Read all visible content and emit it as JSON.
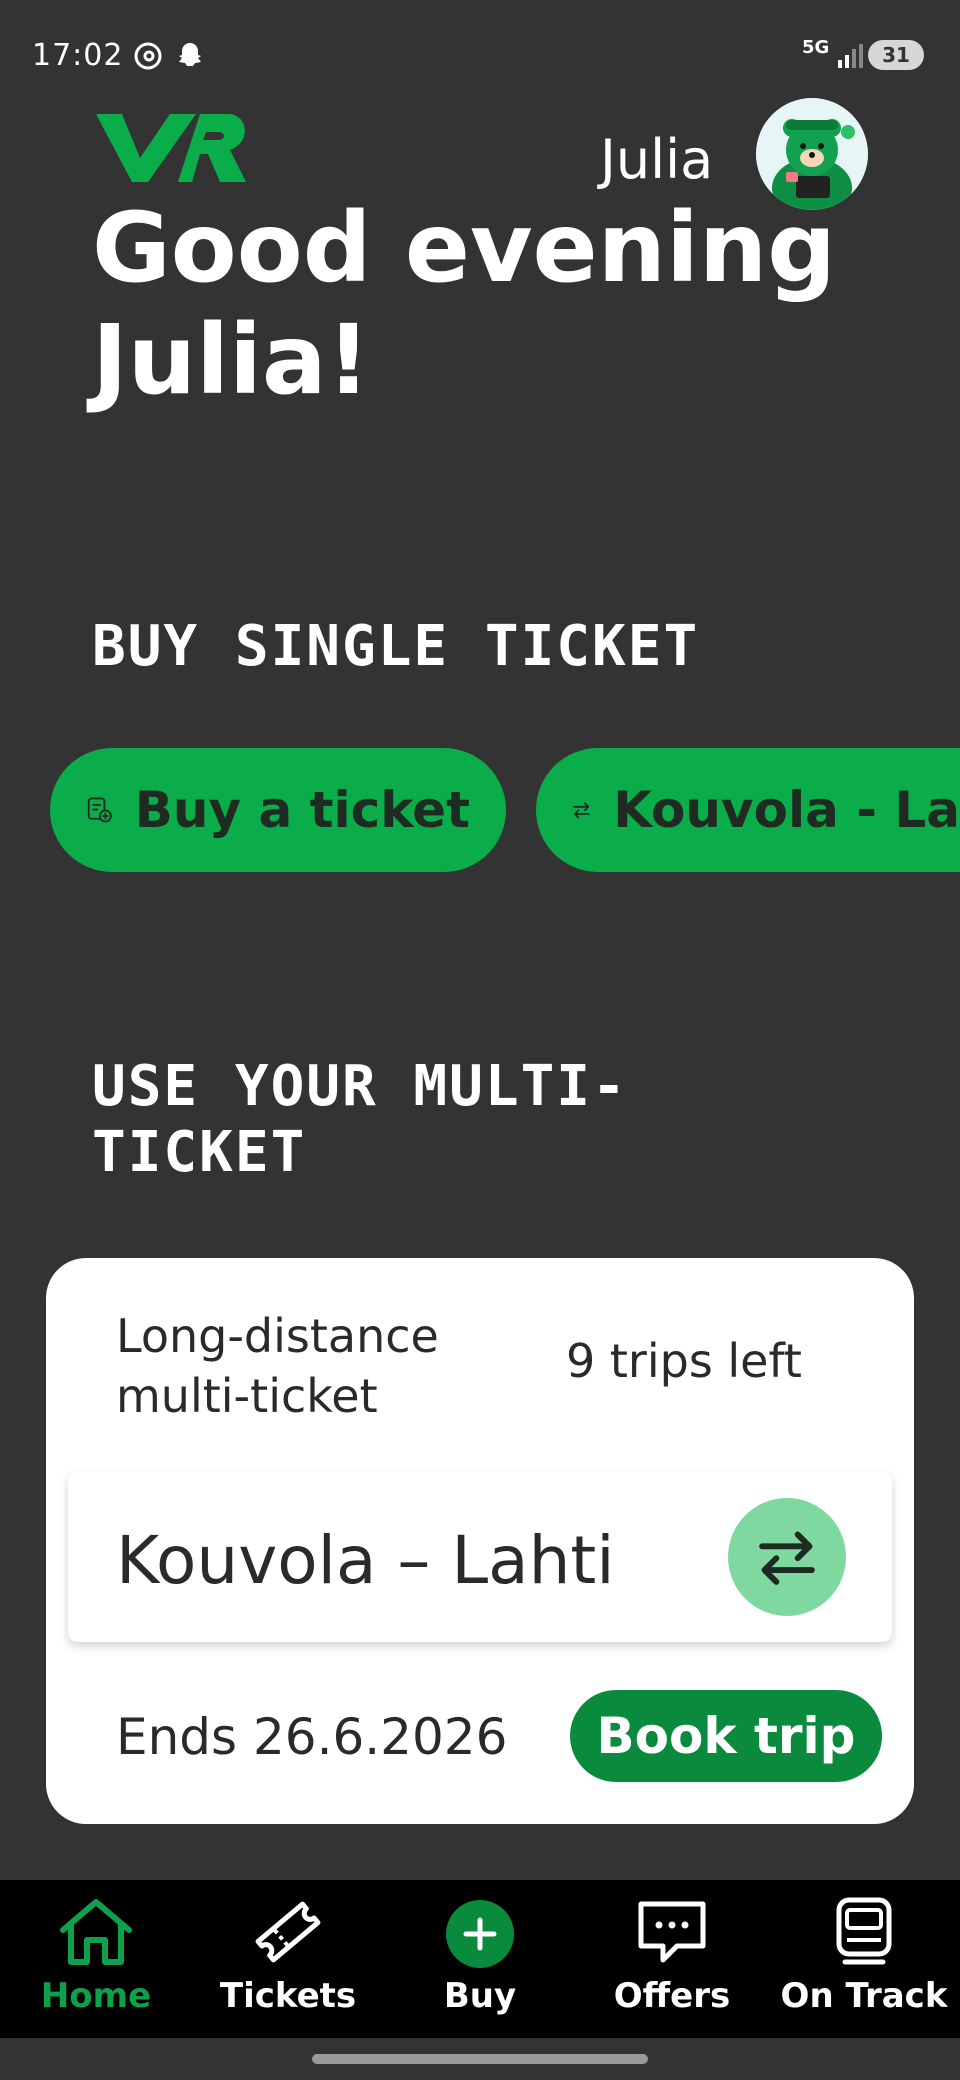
{
  "status_bar": {
    "time": "17:02",
    "network": "5G",
    "battery": "31"
  },
  "header": {
    "logo_text": "VR",
    "user_name": "Julia"
  },
  "greeting": {
    "line1": "Good evening",
    "line2": "Julia!"
  },
  "buy_section": {
    "title": "BUY SINGLE TICKET",
    "buttons": [
      {
        "label": "Buy a ticket",
        "icon": "ticket-add-icon"
      },
      {
        "label": "Kouvola - La",
        "icon": "swap-arrows-icon"
      }
    ]
  },
  "multi_section": {
    "title_line1": "USE YOUR MULTI-",
    "title_line2": "TICKET",
    "card": {
      "ticket_type": "Long-distance multi-ticket",
      "trips_left": "9 trips left",
      "route": "Kouvola – Lahti",
      "ends": "Ends 26.6.2026",
      "book_label": "Book trip"
    }
  },
  "bottom_nav": {
    "items": [
      {
        "label": "Home",
        "icon": "home-icon",
        "active": true
      },
      {
        "label": "Tickets",
        "icon": "ticket-icon",
        "active": false
      },
      {
        "label": "Buy",
        "icon": "plus-circle-icon",
        "active": false
      },
      {
        "label": "Offers",
        "icon": "chat-bubble-icon",
        "active": false
      },
      {
        "label": "On Track",
        "icon": "train-icon",
        "active": false
      }
    ]
  },
  "colors": {
    "background": "#333333",
    "brand_green": "#0bad4b",
    "dark_green": "#0a8a3c",
    "light_green": "#7fd8a0"
  }
}
